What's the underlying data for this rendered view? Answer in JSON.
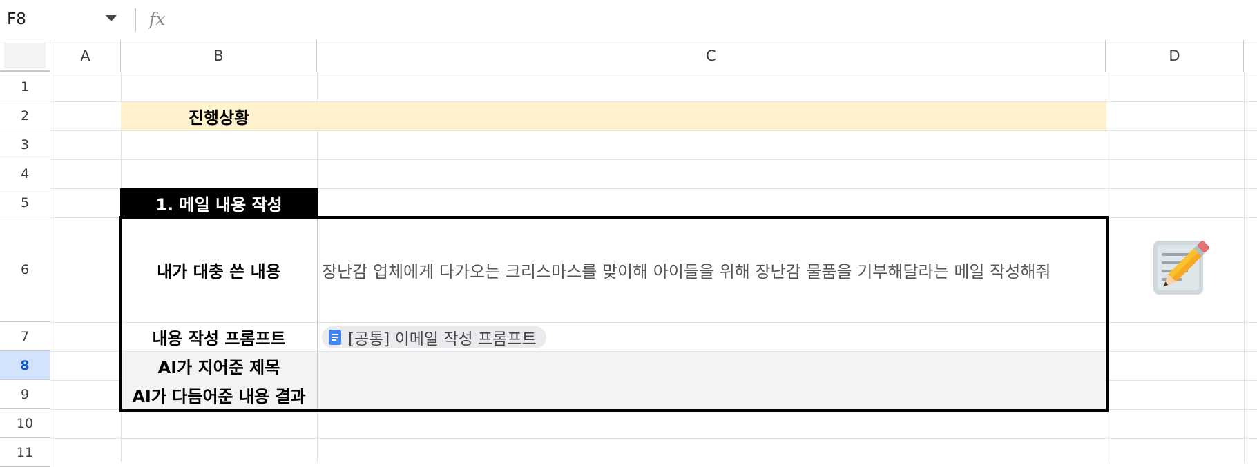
{
  "formula_bar": {
    "cell_ref": "F8",
    "fx_label": "fx",
    "formula": ""
  },
  "columns": [
    "A",
    "B",
    "C",
    "D"
  ],
  "rows": [
    "1",
    "2",
    "3",
    "4",
    "5",
    "6",
    "7",
    "8",
    "9",
    "10",
    "11"
  ],
  "selected_row": "8",
  "cells": {
    "B2": "진행상황",
    "B5": "1. 메일 내용 작성",
    "B6": "내가 대충 쓴 내용",
    "C6": "장난감 업체에게 다가오는 크리스마스를 맞이해 아이들을 위해 장난감 물품을 기부해달라는 메일 작성해줘",
    "B7": "내용 작성 프롬프트",
    "C7_chip": "[공통] 이메일 작성 프롬프트",
    "B8": "AI가 지어준 제목",
    "B9": "AI가 다듬어준 내용 결과"
  },
  "icons": {
    "chip_icon": "google-docs-icon",
    "memo_icon": "memo-pencil-emoji-icon"
  },
  "colors": {
    "progress_fill": "#fff2cc",
    "section_header_bg": "#000000",
    "output_rows_bg": "#f3f3f3",
    "selected_row_header": "#d3e3fd"
  }
}
